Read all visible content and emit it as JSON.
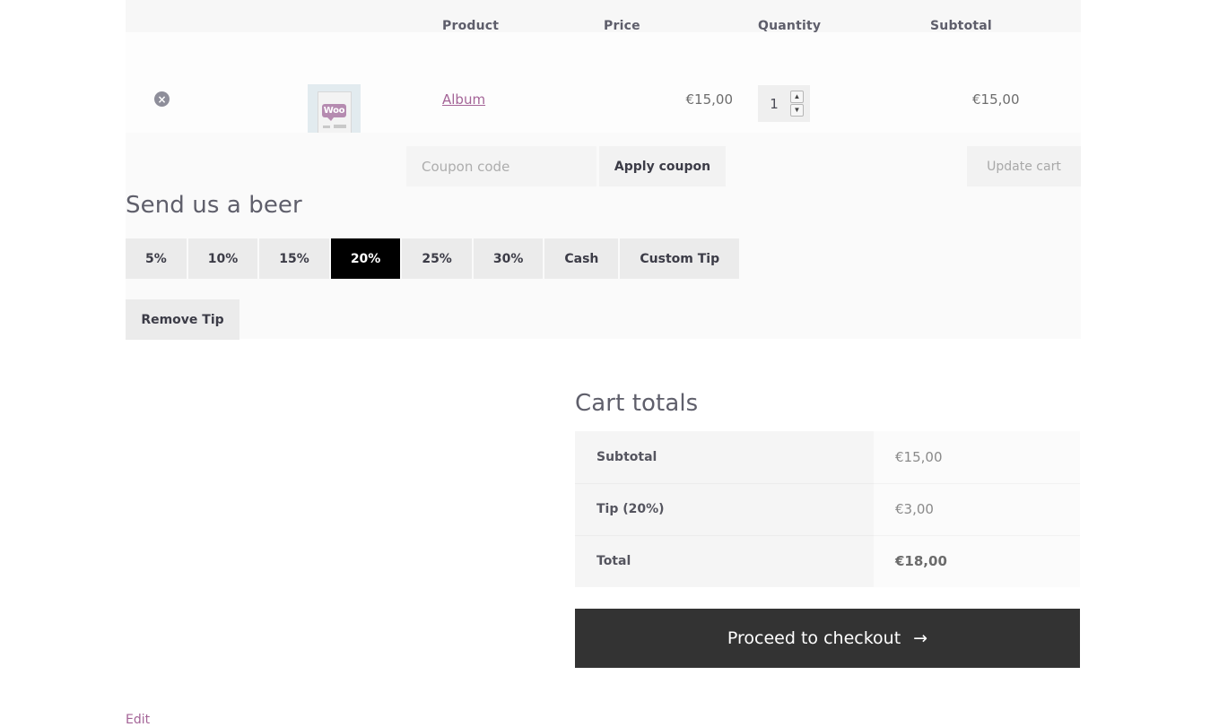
{
  "cart_table": {
    "columns": {
      "remove": "",
      "thumbnail": "",
      "product": "Product",
      "price": "Price",
      "quantity": "Quantity",
      "subtotal": "Subtotal"
    },
    "rows": [
      {
        "remove_label": "×",
        "thumbnail_alt": "woo-placeholder-image",
        "thumbnail_text": "Woo",
        "product_name": "Album",
        "price": "€15,00",
        "quantity": "1",
        "subtotal": "€15,00"
      }
    ]
  },
  "actions": {
    "coupon_placeholder": "Coupon code",
    "coupon_value": "",
    "apply_coupon_label": "Apply coupon",
    "update_cart_label": "Update cart"
  },
  "tip": {
    "title": "Send us a beer",
    "options": [
      {
        "label": "5%",
        "selected": false
      },
      {
        "label": "10%",
        "selected": false
      },
      {
        "label": "15%",
        "selected": false
      },
      {
        "label": "20%",
        "selected": true
      },
      {
        "label": "25%",
        "selected": false
      },
      {
        "label": "30%",
        "selected": false
      },
      {
        "label": "Cash",
        "selected": false
      },
      {
        "label": "Custom Tip",
        "selected": false
      }
    ],
    "remove_label": "Remove Tip"
  },
  "totals": {
    "title": "Cart totals",
    "rows": [
      {
        "label": "Subtotal",
        "value": "€15,00"
      },
      {
        "label": "Tip (20%)",
        "value": "€3,00"
      },
      {
        "label": "Total",
        "value": "€18,00"
      }
    ],
    "checkout_label": "Proceed to checkout",
    "checkout_arrow": "→"
  },
  "footer": {
    "edit_label": "Edit"
  },
  "colors": {
    "accent_link": "#a46497",
    "selected_tip_bg": "#000000",
    "checkout_bg": "#333333",
    "panel_bg": "#fafafa",
    "header_bg": "#f7f7f7"
  },
  "icons": {
    "remove": "close-circle-icon",
    "stepper_up": "chevron-up-icon",
    "stepper_down": "chevron-down-icon",
    "arrow": "arrow-right-icon"
  }
}
